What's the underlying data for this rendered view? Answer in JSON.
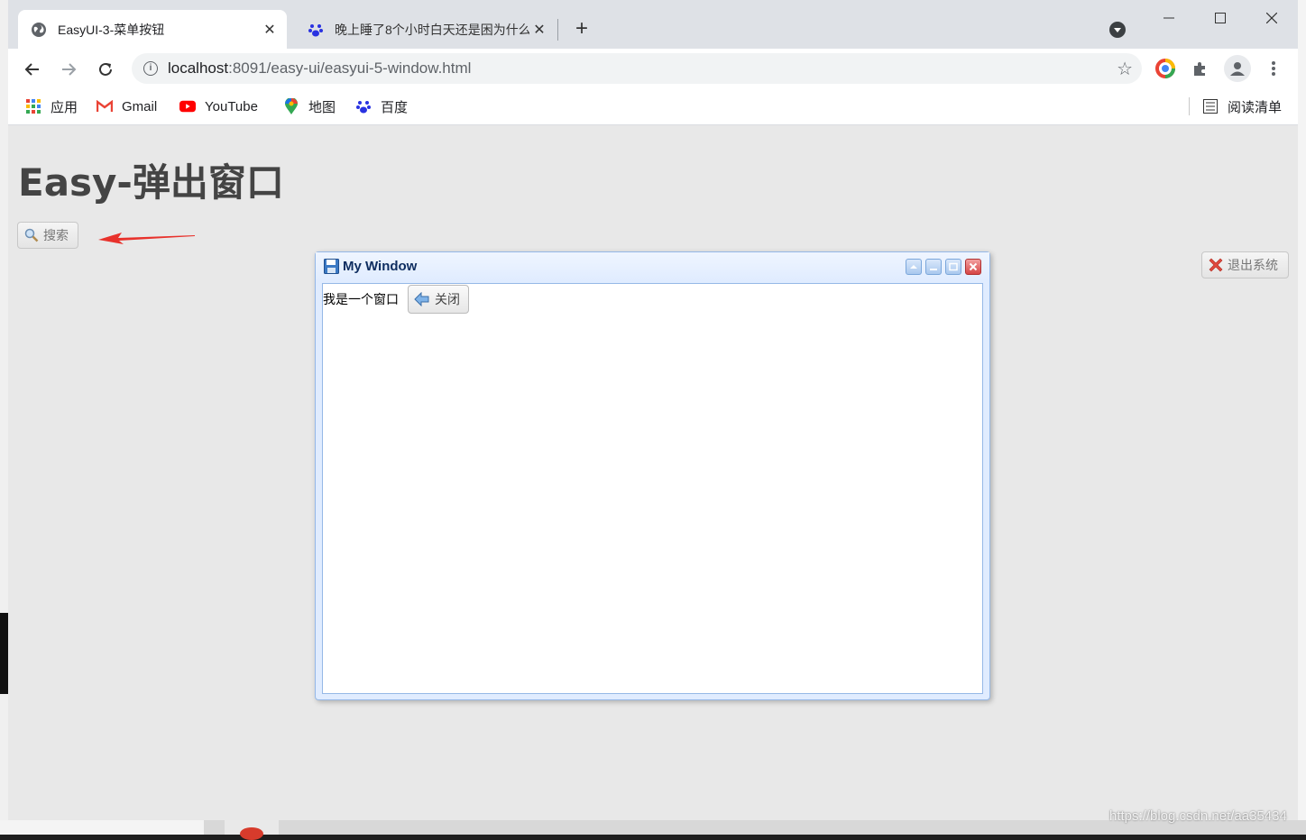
{
  "tabs": [
    {
      "title": "EasyUI-3-菜单按钮",
      "active": true,
      "favicon": "globe-icon"
    },
    {
      "title": "晚上睡了8个小时白天还是困为什么",
      "active": false,
      "favicon": "baidu-paw-icon"
    }
  ],
  "address_bar": {
    "host": "localhost",
    "path": ":8091/easy-ui/easyui-5-window.html"
  },
  "bookmarks": [
    {
      "label": "应用",
      "icon": "apps-grid-icon"
    },
    {
      "label": "Gmail",
      "icon": "gmail-icon"
    },
    {
      "label": "YouTube",
      "icon": "youtube-icon"
    },
    {
      "label": "地图",
      "icon": "maps-pin-icon"
    },
    {
      "label": "百度",
      "icon": "baidu-paw-icon"
    }
  ],
  "reading_list": "阅读清单",
  "page": {
    "heading": "Easy-弹出窗口",
    "search_button": "搜索",
    "logout_button": "退出系统"
  },
  "window": {
    "title": "My Window",
    "content_text": "我是一个窗口",
    "close_button": "关闭"
  },
  "watermark": "https://blog.csdn.net/aa35434",
  "colors": {
    "window_border": "#95b8e7",
    "window_header": "#e0ecff",
    "window_title": "#0e2d5f",
    "annotation_arrow": "#e8322c"
  }
}
